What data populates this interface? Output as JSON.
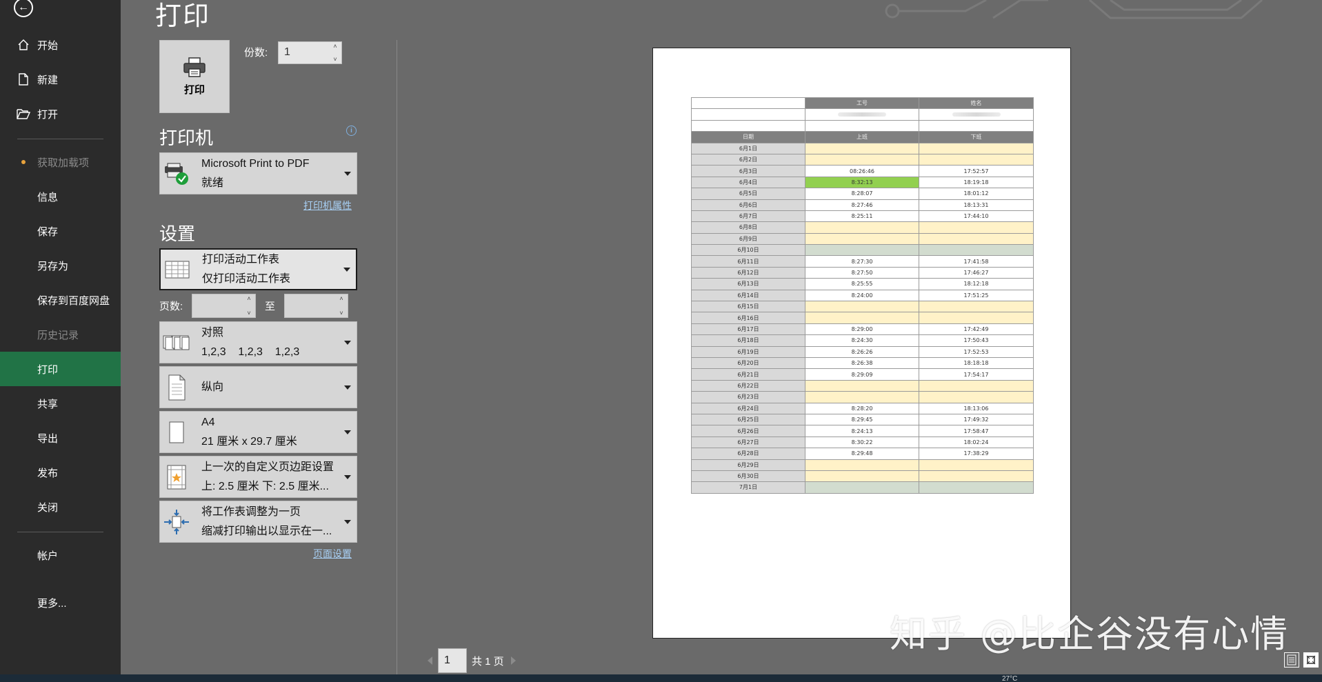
{
  "page": {
    "title": "打印"
  },
  "sidebar": {
    "items": [
      {
        "label": "开始",
        "icon": "home-icon",
        "state": "normal"
      },
      {
        "label": "新建",
        "icon": "new-document-icon",
        "state": "normal"
      },
      {
        "label": "打开",
        "icon": "folder-open-icon",
        "state": "normal"
      },
      {
        "label": "获取加载项",
        "icon": "",
        "state": "disabled"
      },
      {
        "label": "信息",
        "state": "normal"
      },
      {
        "label": "保存",
        "state": "normal"
      },
      {
        "label": "另存为",
        "state": "normal"
      },
      {
        "label": "保存到百度网盘",
        "state": "normal"
      },
      {
        "label": "历史记录",
        "state": "disabled"
      },
      {
        "label": "打印",
        "state": "active"
      },
      {
        "label": "共享",
        "state": "normal"
      },
      {
        "label": "导出",
        "state": "normal"
      },
      {
        "label": "发布",
        "state": "normal"
      },
      {
        "label": "关闭",
        "state": "normal"
      },
      {
        "label": "帐户",
        "state": "normal"
      },
      {
        "label": "更多...",
        "state": "normal"
      }
    ]
  },
  "print_button": {
    "label": "打印"
  },
  "copies": {
    "label": "份数:",
    "value": "1"
  },
  "printer": {
    "section_title": "打印机",
    "name": "Microsoft Print to PDF",
    "status": "就绪",
    "properties_link": "打印机属性"
  },
  "settings": {
    "section_title": "设置",
    "what_to_print": {
      "line1": "打印活动工作表",
      "line2": "仅打印活动工作表"
    },
    "pages_label": "页数:",
    "to_label": "至",
    "collate": {
      "line1": "对照",
      "line2": "1,2,3    1,2,3    1,2,3"
    },
    "orientation": {
      "line1": "纵向"
    },
    "paper_size": {
      "line1": "A4",
      "line2": "21 厘米 x 29.7 厘米"
    },
    "margins": {
      "line1": "上一次的自定义页边距设置",
      "line2": "上: 2.5 厘米 下: 2.5 厘米..."
    },
    "scaling": {
      "line1": "将工作表调整为一页",
      "line2": "缩减打印输出以显示在一..."
    },
    "page_setup_link": "页面设置"
  },
  "preview": {
    "header": {
      "col1": "工号",
      "col2": "姓名"
    },
    "subheader": {
      "date": "日期",
      "am": "上班",
      "pm": "下班"
    },
    "rows": [
      {
        "date": "6月1日",
        "am": "",
        "pm": "",
        "style": "yellow"
      },
      {
        "date": "6月2日",
        "am": "",
        "pm": "",
        "style": "yellow"
      },
      {
        "date": "6月3日",
        "am": "08:26:46",
        "pm": "17:52:57",
        "style": "white"
      },
      {
        "date": "6月4日",
        "am": "8:32:13",
        "pm": "18:19:18",
        "style": "highlight"
      },
      {
        "date": "6月5日",
        "am": "8:28:07",
        "pm": "18:01:12",
        "style": "white"
      },
      {
        "date": "6月6日",
        "am": "8:27:46",
        "pm": "18:13:31",
        "style": "white"
      },
      {
        "date": "6月7日",
        "am": "8:25:11",
        "pm": "17:44:10",
        "style": "white"
      },
      {
        "date": "6月8日",
        "am": "",
        "pm": "",
        "style": "yellow"
      },
      {
        "date": "6月9日",
        "am": "",
        "pm": "",
        "style": "yellow"
      },
      {
        "date": "6月10日",
        "am": "",
        "pm": "",
        "style": "green"
      },
      {
        "date": "6月11日",
        "am": "8:27:30",
        "pm": "17:41:58",
        "style": "white"
      },
      {
        "date": "6月12日",
        "am": "8:27:50",
        "pm": "17:46:27",
        "style": "white"
      },
      {
        "date": "6月13日",
        "am": "8:25:55",
        "pm": "18:12:18",
        "style": "white"
      },
      {
        "date": "6月14日",
        "am": "8:24:00",
        "pm": "17:51:25",
        "style": "white"
      },
      {
        "date": "6月15日",
        "am": "",
        "pm": "",
        "style": "yellow"
      },
      {
        "date": "6月16日",
        "am": "",
        "pm": "",
        "style": "yellow"
      },
      {
        "date": "6月17日",
        "am": "8:29:00",
        "pm": "17:42:49",
        "style": "white"
      },
      {
        "date": "6月18日",
        "am": "8:24:30",
        "pm": "17:50:43",
        "style": "white"
      },
      {
        "date": "6月19日",
        "am": "8:26:26",
        "pm": "17:52:53",
        "style": "white"
      },
      {
        "date": "6月20日",
        "am": "8:26:38",
        "pm": "18:18:18",
        "style": "white"
      },
      {
        "date": "6月21日",
        "am": "8:29:09",
        "pm": "17:54:17",
        "style": "white"
      },
      {
        "date": "6月22日",
        "am": "",
        "pm": "",
        "style": "yellow"
      },
      {
        "date": "6月23日",
        "am": "",
        "pm": "",
        "style": "yellow"
      },
      {
        "date": "6月24日",
        "am": "8:28:20",
        "pm": "18:13:06",
        "style": "white"
      },
      {
        "date": "6月25日",
        "am": "8:29:45",
        "pm": "17:49:32",
        "style": "white"
      },
      {
        "date": "6月26日",
        "am": "8:24:13",
        "pm": "17:58:47",
        "style": "white"
      },
      {
        "date": "6月27日",
        "am": "8:30:22",
        "pm": "18:02:24",
        "style": "white"
      },
      {
        "date": "6月28日",
        "am": "8:29:48",
        "pm": "17:38:29",
        "style": "white"
      },
      {
        "date": "6月29日",
        "am": "",
        "pm": "",
        "style": "yellow"
      },
      {
        "date": "6月30日",
        "am": "",
        "pm": "",
        "style": "yellow"
      },
      {
        "date": "7月1日",
        "am": "",
        "pm": "",
        "style": "green"
      }
    ]
  },
  "page_nav": {
    "current": "1",
    "total_label": "共 1 页"
  },
  "watermark": "知乎 @比企谷没有心情",
  "taskbar": {
    "temperature": "27°C"
  },
  "colors": {
    "sidebar_bg": "#2b2b2b",
    "active": "#217346",
    "panel_bg": "#6a6a6a",
    "highlight_cell": "#92d050",
    "weekend_cell": "#fff2c8"
  }
}
